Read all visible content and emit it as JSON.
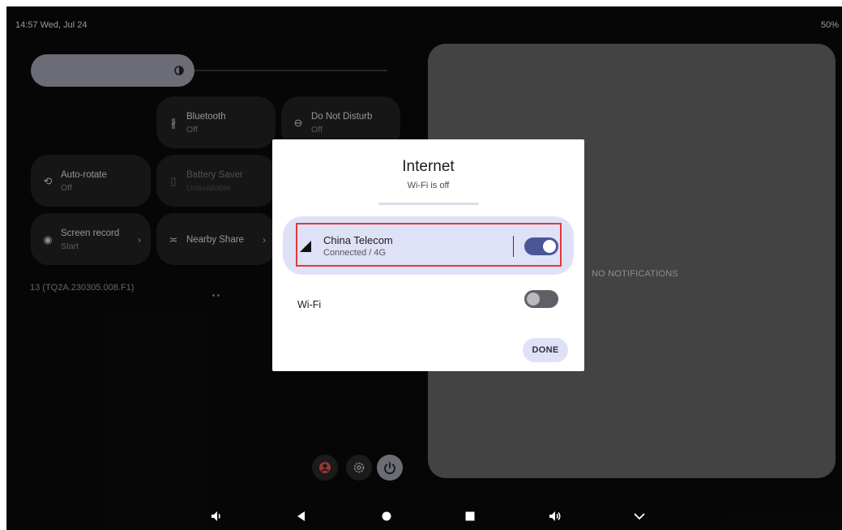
{
  "status_bar": {
    "time_date": "14:57  Wed, Jul 24",
    "battery": "50%"
  },
  "quick_settings": {
    "tiles": [
      {
        "label": "Bluetooth",
        "state": "Off"
      },
      {
        "label": "Do Not Disturb",
        "state": "Off"
      },
      {
        "label": "Auto-rotate",
        "state": "Off"
      },
      {
        "label": "Battery Saver",
        "state": "Unavailable"
      },
      {
        "label": "Screen record",
        "state": "Start"
      },
      {
        "label": "Nearby Share",
        "state": ""
      }
    ],
    "build_number": "13 (TQ2A.230305.008.F1)"
  },
  "notifications": {
    "empty_label": "NO NOTIFICATIONS"
  },
  "internet_dialog": {
    "title": "Internet",
    "subtitle": "Wi-Fi is off",
    "mobile": {
      "carrier": "China Telecom",
      "status": "Connected / 4G",
      "enabled": true
    },
    "wifi": {
      "label": "Wi-Fi",
      "enabled": false
    },
    "done_label": "DONE"
  },
  "colors": {
    "accent": "#4a5796",
    "highlight": "#e23a3a",
    "cell_bg": "#dfe1f7"
  }
}
